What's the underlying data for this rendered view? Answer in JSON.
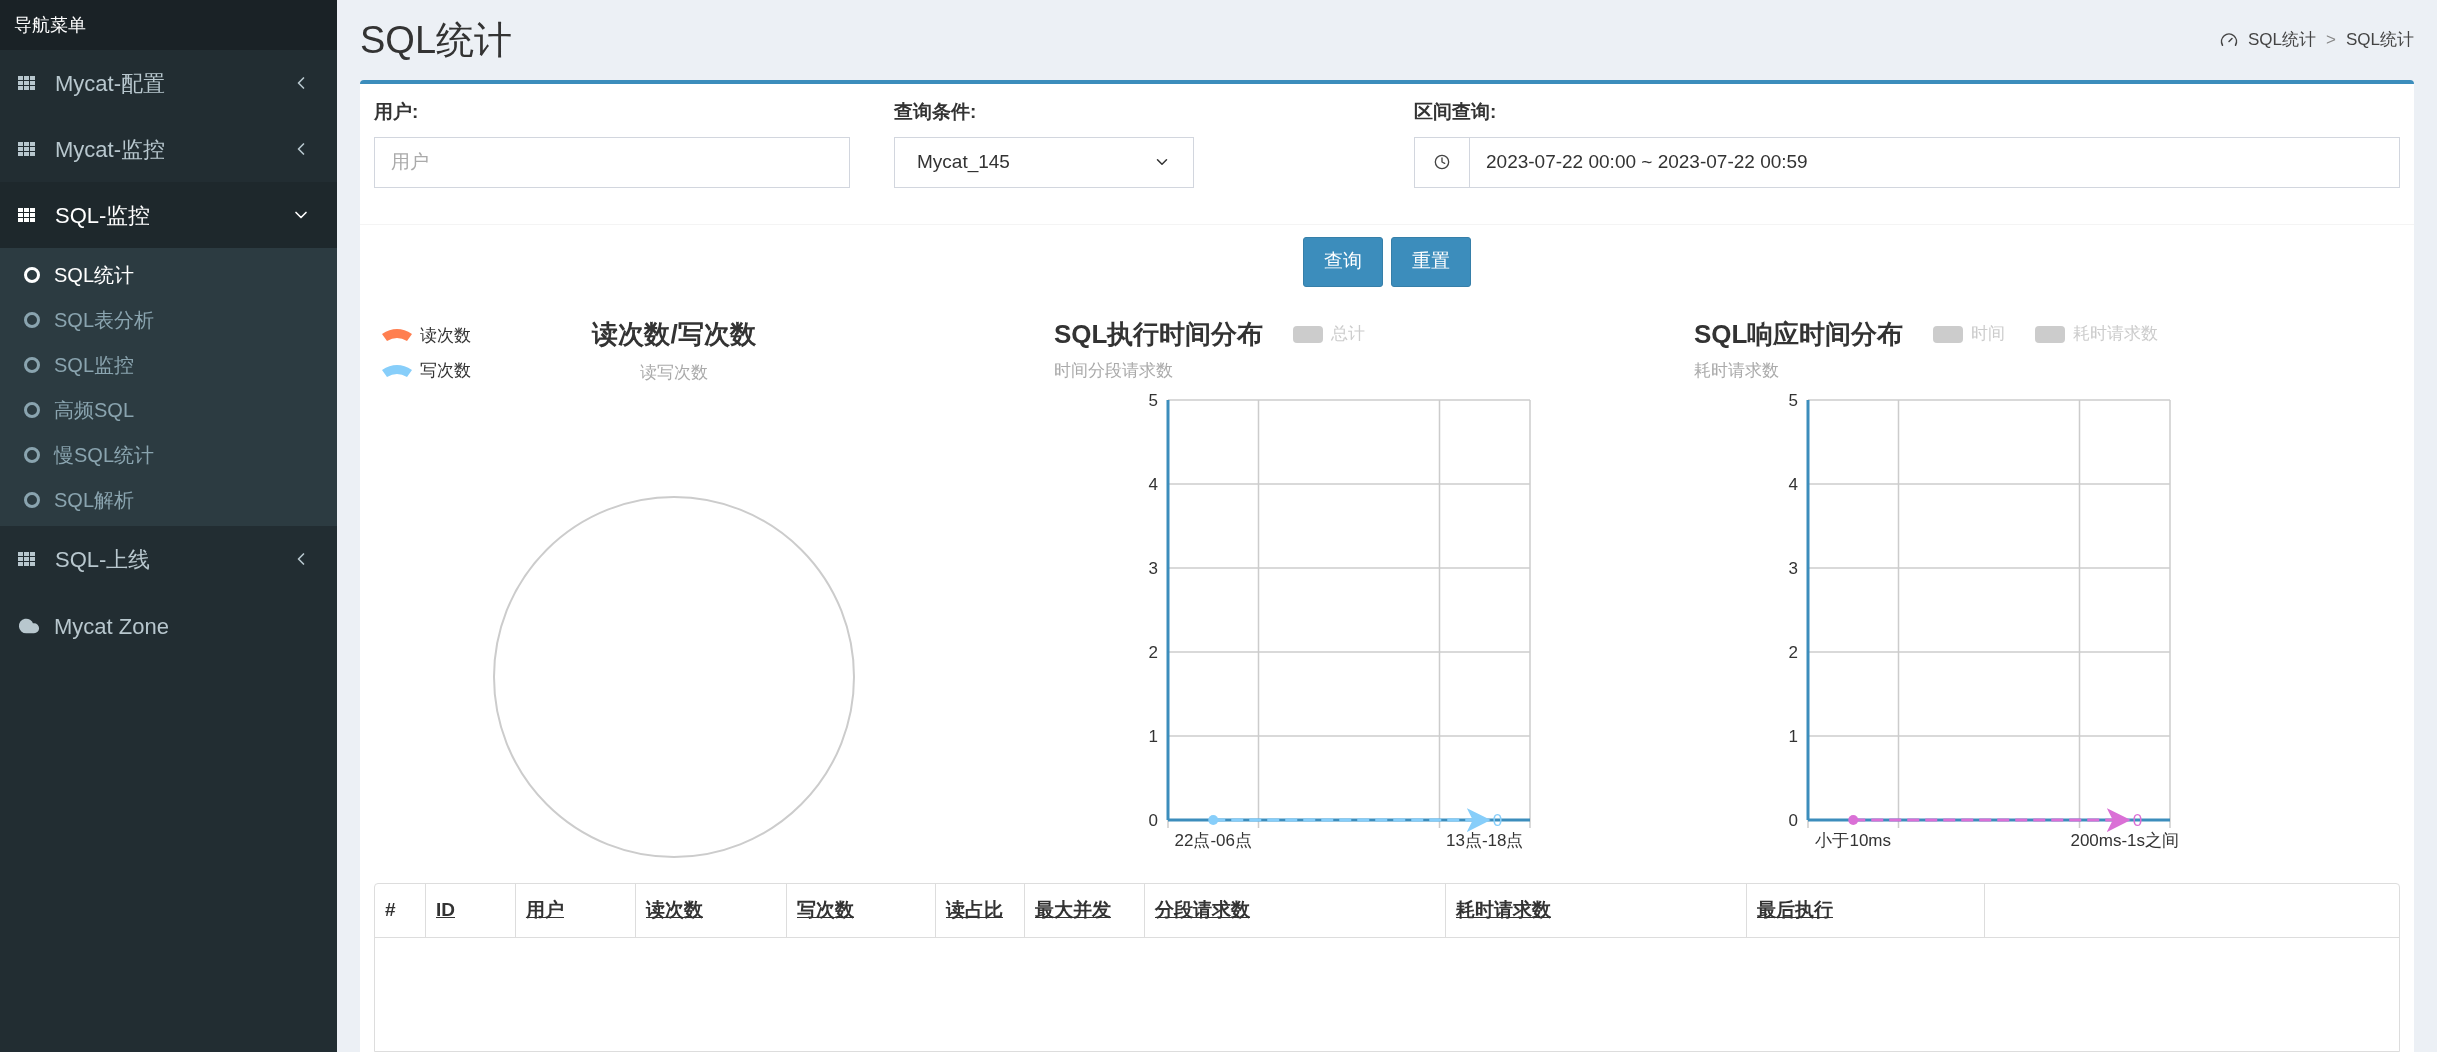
{
  "sidebar": {
    "header": "导航菜单",
    "items": [
      {
        "kind": "group",
        "label": "Mycat-配置",
        "expanded": false
      },
      {
        "kind": "group",
        "label": "Mycat-监控",
        "expanded": false
      },
      {
        "kind": "group",
        "label": "SQL-监控",
        "expanded": true,
        "children": [
          {
            "label": "SQL统计",
            "selected": true
          },
          {
            "label": "SQL表分析",
            "selected": false
          },
          {
            "label": "SQL监控",
            "selected": false
          },
          {
            "label": "高频SQL",
            "selected": false
          },
          {
            "label": "慢SQL统计",
            "selected": false
          },
          {
            "label": "SQL解析",
            "selected": false
          }
        ]
      },
      {
        "kind": "group",
        "label": "SQL-上线",
        "expanded": false
      },
      {
        "kind": "link",
        "label": "Mycat Zone"
      }
    ]
  },
  "page": {
    "title": "SQL统计",
    "breadcrumb": [
      "SQL统计",
      ">",
      "SQL统计"
    ]
  },
  "form": {
    "user": {
      "label": "用户:",
      "placeholder": "用户"
    },
    "condition": {
      "label": "查询条件:",
      "value": "Mycat_145"
    },
    "range": {
      "label": "区间查询:",
      "value": "2023-07-22 00:00 ~ 2023-07-22 00:59"
    },
    "buttons": [
      "查询",
      "重置"
    ]
  },
  "charts": [
    {
      "kind": "pie",
      "title": "读次数/写次数",
      "subtitle": "读写次数",
      "legend": [
        {
          "label": "读次数",
          "color": "#ff7f50"
        },
        {
          "label": "写次数",
          "color": "#87cefa"
        }
      ]
    },
    {
      "title": "SQL执行时间分布",
      "subtitle": "时间分段请求数",
      "legend": [
        {
          "label": "总计",
          "active": false
        }
      ],
      "end_label": "0",
      "kind": "line",
      "chart_data": {
        "type": "line",
        "categories": [
          "22点-06点",
          "13点-18点"
        ],
        "series": [
          {
            "color": "#87cefa",
            "values": [
              0,
              0
            ],
            "line_style": "dashed"
          }
        ],
        "ylim": [
          0,
          5
        ],
        "yticks": [
          0,
          1,
          2,
          3,
          4,
          5
        ],
        "grid": true
      }
    },
    {
      "title": "SQL响应时间分布",
      "subtitle": "耗时请求数",
      "legend": [
        {
          "label": "时间",
          "active": false
        },
        {
          "label": "耗时请求数",
          "active": false
        }
      ],
      "end_label": "0",
      "kind": "line",
      "chart_data": {
        "type": "line",
        "categories": [
          "小于10ms",
          "200ms-1s之间"
        ],
        "series": [
          {
            "color": "#da70d6",
            "values": [
              0,
              0
            ],
            "line_style": "dashed"
          }
        ],
        "ylim": [
          0,
          5
        ],
        "yticks": [
          0,
          1,
          2,
          3,
          4,
          5
        ],
        "grid": true
      }
    }
  ],
  "table": {
    "columns": [
      {
        "label": "#",
        "sortable": false
      },
      {
        "label": "ID",
        "sortable": true
      },
      {
        "label": "用户",
        "sortable": true
      },
      {
        "label": "读次数",
        "sortable": true
      },
      {
        "label": "写次数",
        "sortable": true
      },
      {
        "label": "读占比",
        "sortable": true
      },
      {
        "label": "最大并发",
        "sortable": true
      },
      {
        "label": "分段请求数",
        "sortable": true
      },
      {
        "label": "耗时请求数",
        "sortable": true
      },
      {
        "label": "最后执行",
        "sortable": true
      }
    ]
  }
}
